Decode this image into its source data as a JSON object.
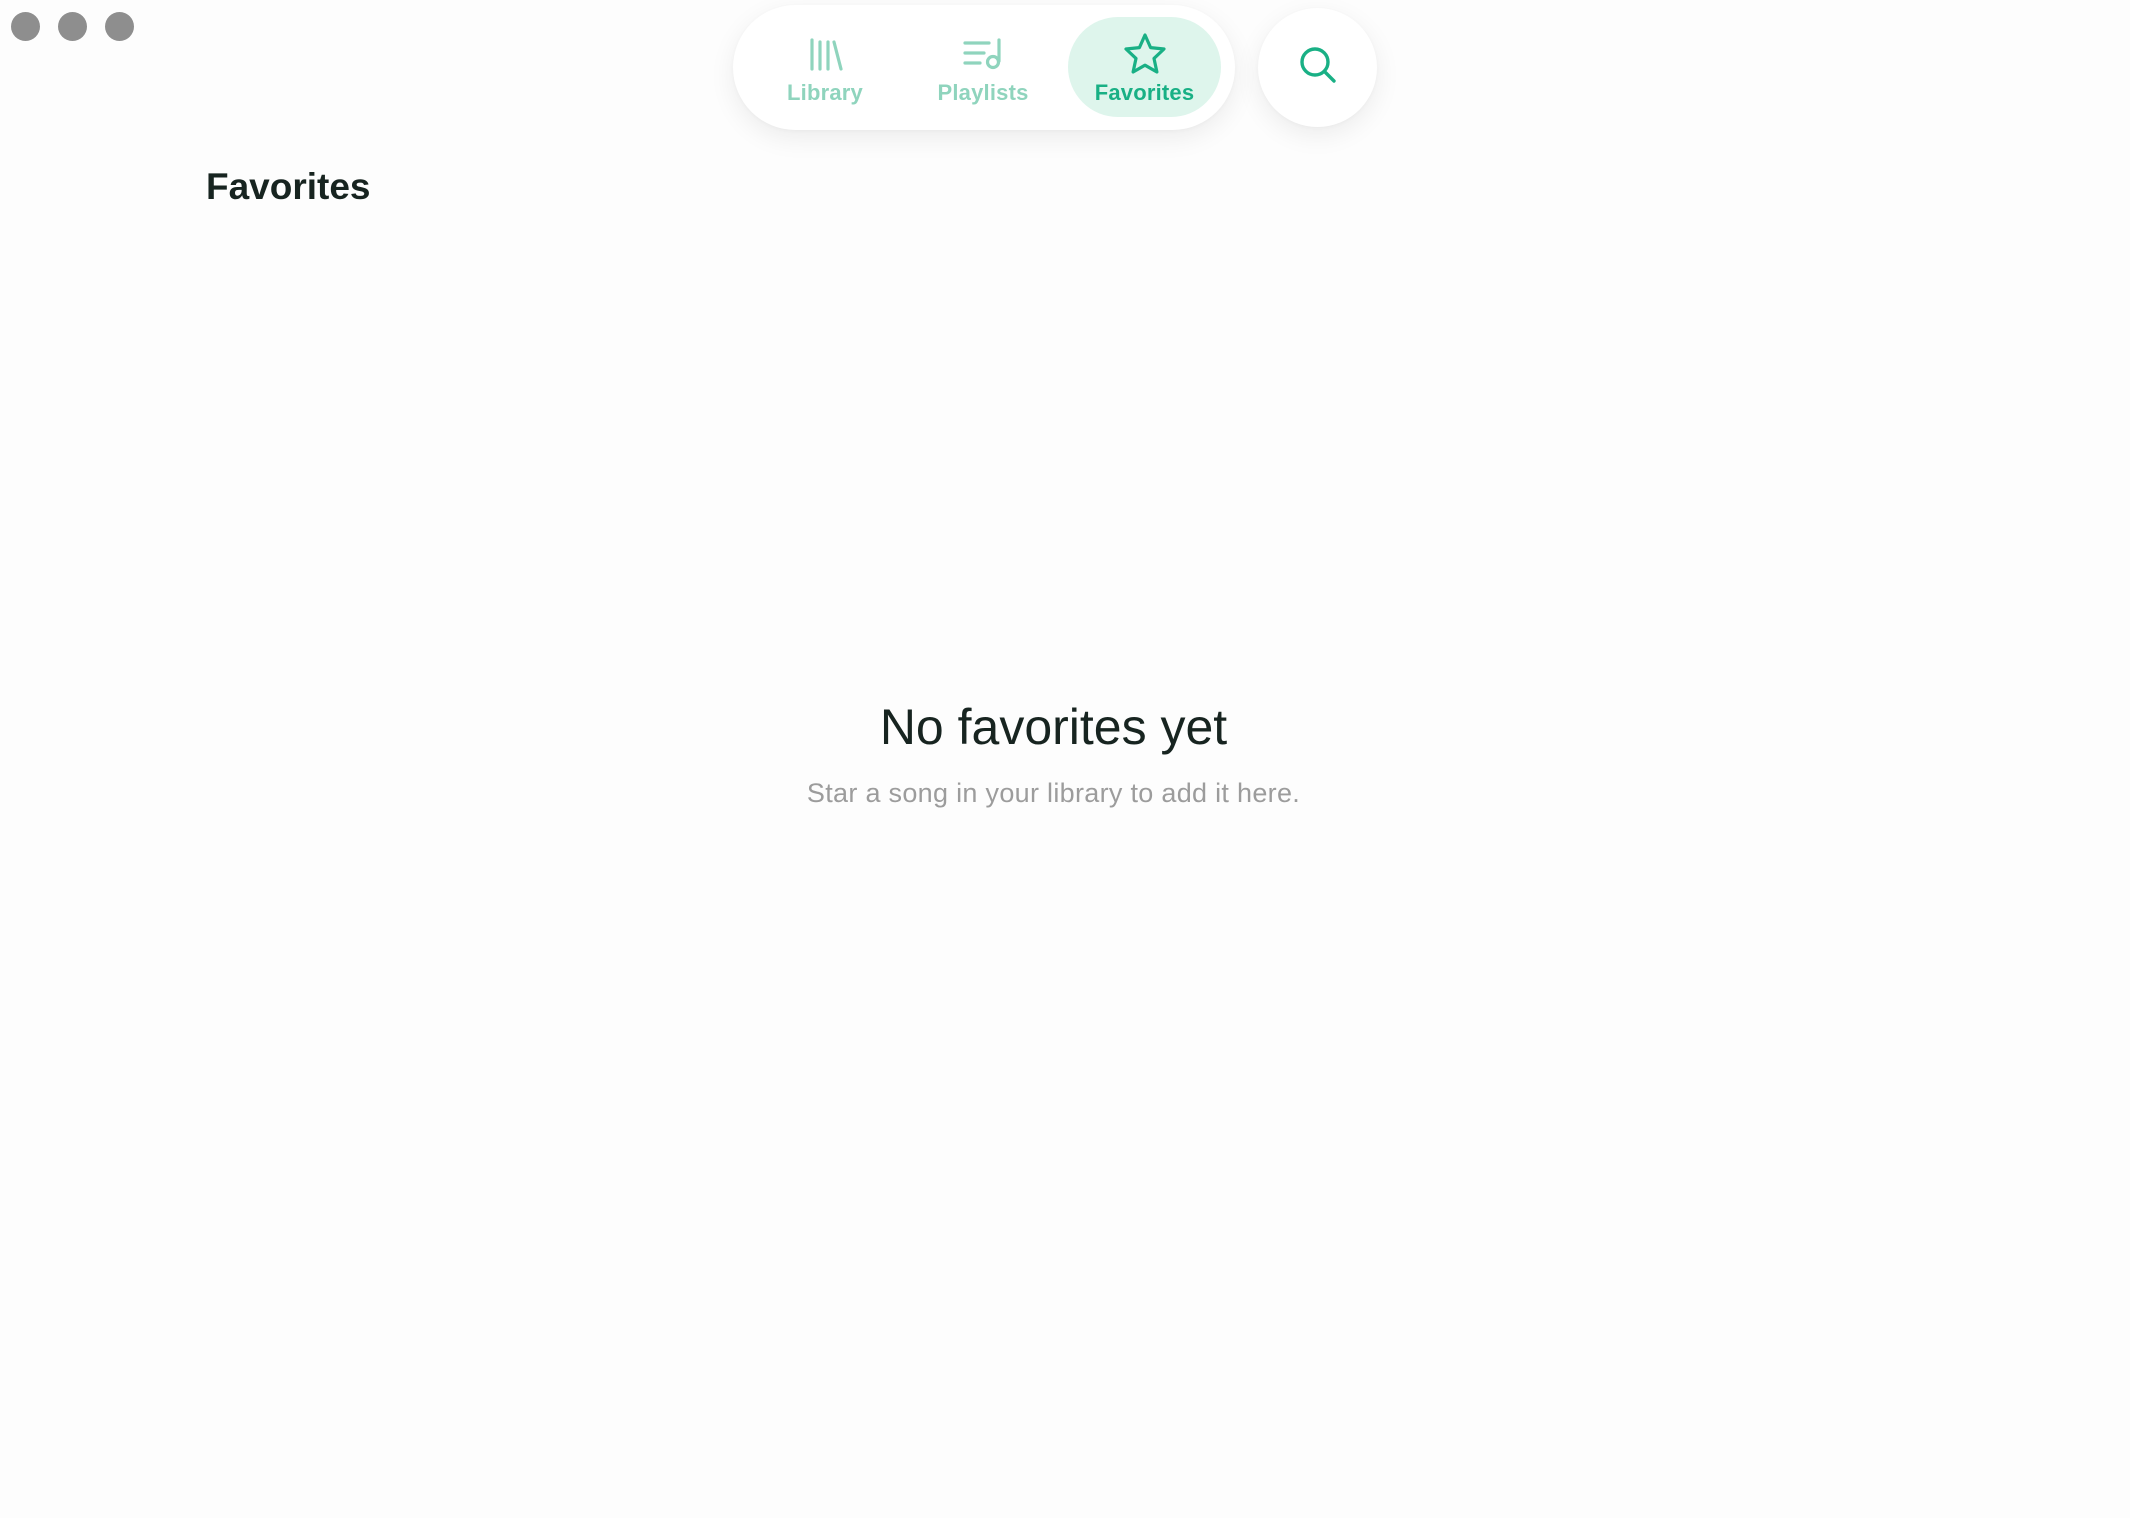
{
  "window": {
    "traffic_lights": [
      "close",
      "minimize",
      "zoom"
    ]
  },
  "nav": {
    "tabs": [
      {
        "label": "Library",
        "icon": "library-icon",
        "active": false
      },
      {
        "label": "Playlists",
        "icon": "playlist-music-icon",
        "active": false
      },
      {
        "label": "Favorites",
        "icon": "star-icon",
        "active": true
      }
    ],
    "search_icon": "search-icon"
  },
  "page": {
    "title": "Favorites"
  },
  "empty_state": {
    "title": "No favorites yet",
    "subtitle": "Star a song in your library to add it here."
  },
  "colors": {
    "accent": "#19b085",
    "accent_muted": "#8fd4bd",
    "active_tab_bg": "#def5ec",
    "text_primary": "#172420",
    "text_secondary": "#9c9c9c",
    "traffic_light": "#8e8e8e",
    "background": "#fdfdfd"
  }
}
